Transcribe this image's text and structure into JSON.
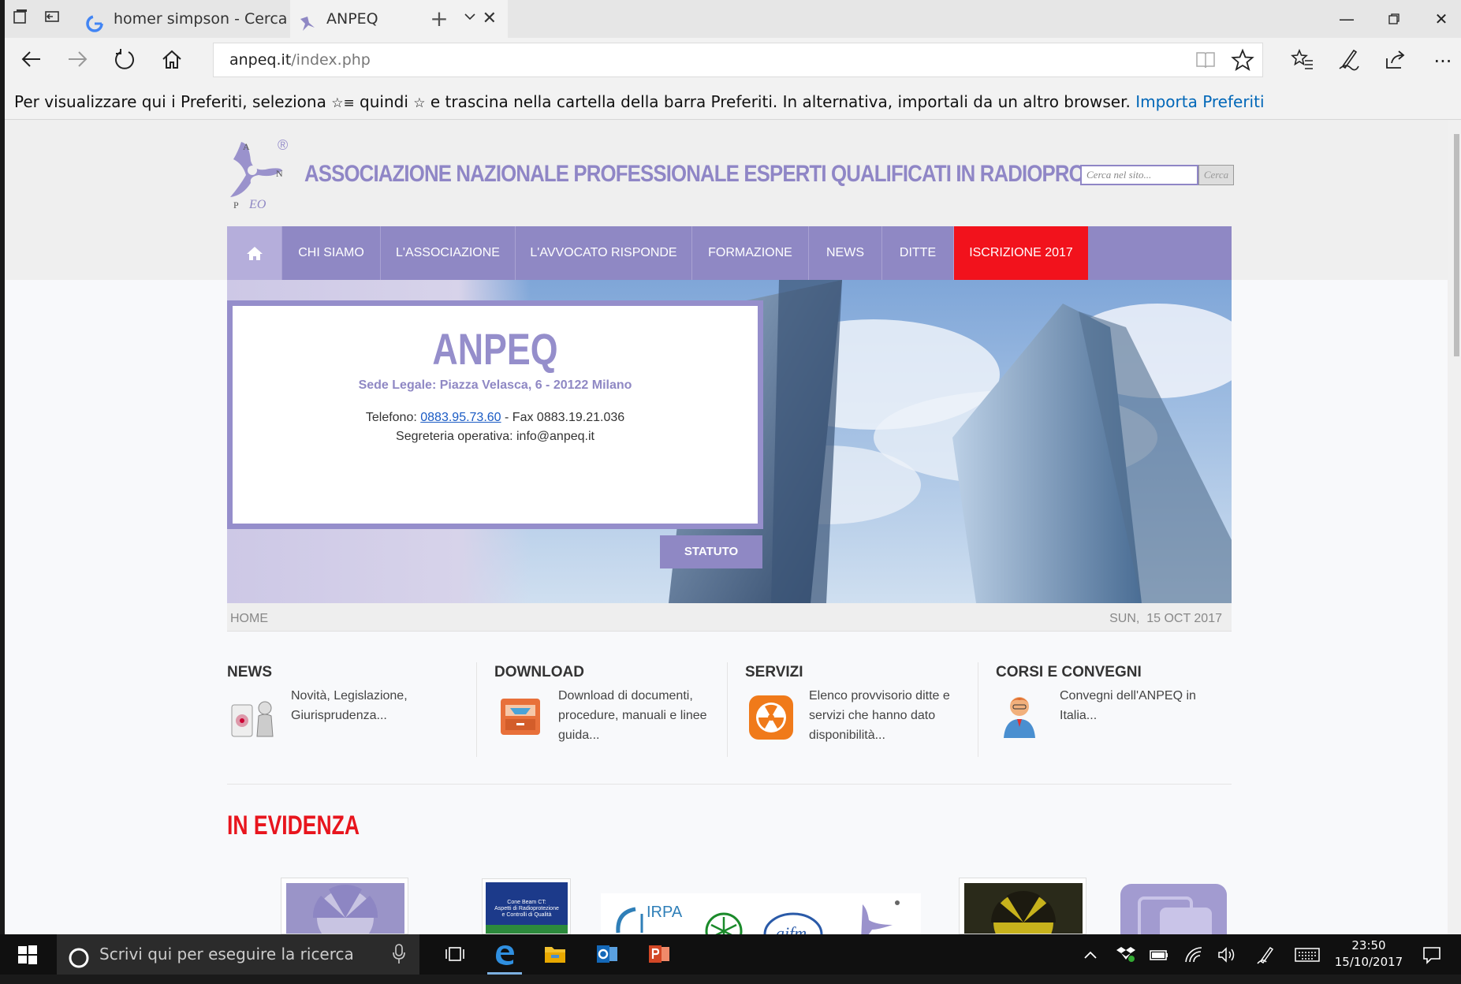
{
  "browser": {
    "tabs": [
      {
        "title": "homer simpson - Cerca con",
        "favicon": "google-icon"
      },
      {
        "title": "ANPEQ",
        "favicon": "anpeq-logo-icon"
      }
    ],
    "window_controls": [
      "minimize-icon",
      "restore-icon",
      "close-icon"
    ],
    "url_host": "anpeq.it",
    "url_path": "/index.php",
    "favorites_bar": {
      "text_1": "Per visualizzare qui i Preferiti, seleziona",
      "text_2": "quindi",
      "text_3": "e trascina nella cartella della barra Preferiti. In alternativa, importali da un altro browser.",
      "link": "Importa Preferiti"
    }
  },
  "site": {
    "logo_letters": {
      "a": "A",
      "n": "N",
      "p": "P",
      "eq": "EQ",
      "reg": "®"
    },
    "title": "ASSOCIAZIONE NAZIONALE PROFESSIONALE ESPERTI QUALIFICATI IN RADIOPROTEZIONE",
    "search_placeholder": "Cerca nel sito...",
    "search_button": "Cerca",
    "menu": [
      {
        "label": "CHI SIAMO"
      },
      {
        "label": "L'ASSOCIAZIONE"
      },
      {
        "label": "L'AVVOCATO RISPONDE"
      },
      {
        "label": "FORMAZIONE"
      },
      {
        "label": "NEWS"
      },
      {
        "label": "DITTE"
      },
      {
        "label": "ISCRIZIONE 2017"
      }
    ],
    "hero": {
      "title": "ANPEQ",
      "address": "Sede Legale: Piazza Velasca, 6 - 20122 Milano",
      "phone_label": "Telefono:",
      "phone": "0883.95.73.60",
      "fax": "- Fax 0883.19.21.036",
      "secretary": "Segreteria operativa: info@anpeq.it",
      "statuto_button": "STATUTO"
    },
    "breadcrumb": "HOME",
    "date": "SUN,  15 OCT 2017",
    "sections": [
      {
        "title": "NEWS",
        "text": "Novità, Legislazione, Giurisprudenza..."
      },
      {
        "title": "DOWNLOAD",
        "text": "Download di documenti, procedure, manuali e linee guida..."
      },
      {
        "title": "SERVIZI",
        "text": "Elenco provvisorio ditte e servizi che hanno dato disponibilità..."
      },
      {
        "title": "CORSI E CONVEGNI",
        "text": "Convegni dell'ANPEQ in Italia..."
      }
    ],
    "evidenza_title": "IN EVIDENZA",
    "evidenza_items": {
      "book_line1": "Cone Beam CT:",
      "book_line2": "Aspetti di Radioprotezione",
      "book_line3": "e Controlli di Qualità",
      "airpa": "IRPA",
      "aifm": "aifm"
    }
  },
  "taskbar": {
    "search_placeholder": "Scrivi qui per eseguire la ricerca",
    "time": "23:50",
    "date": "15/10/2017",
    "apps": [
      "task-view-icon",
      "edge-icon",
      "file-explorer-icon",
      "outlook-icon",
      "powerpoint-icon"
    ]
  },
  "colors": {
    "accent": "#8f88c4",
    "red": "#f2121c",
    "link": "#0067b8"
  }
}
